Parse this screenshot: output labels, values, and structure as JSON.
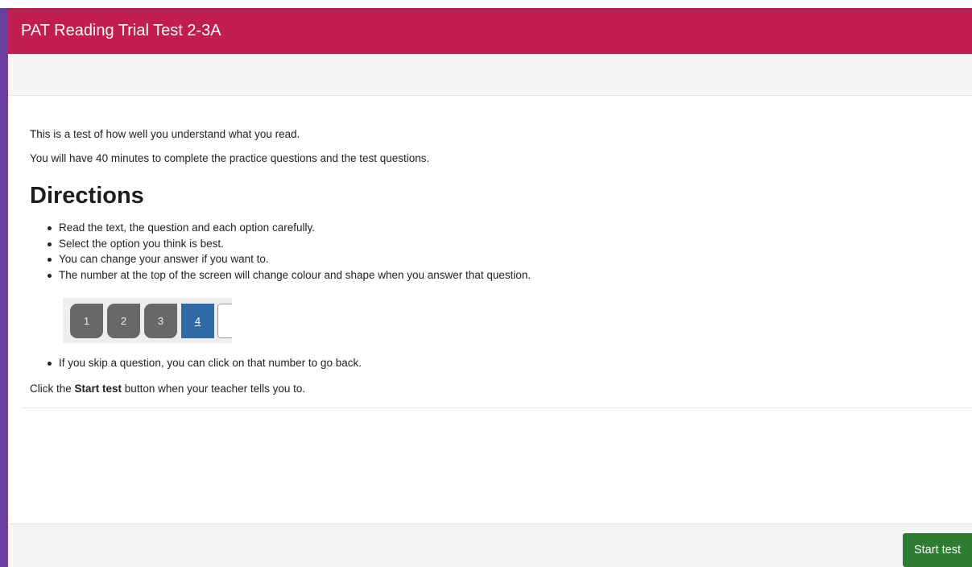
{
  "header": {
    "title": "PAT Reading Trial Test 2-3A"
  },
  "intro": {
    "line1": "This is a test of how well you understand what you read.",
    "line2": "You will have 40 minutes to complete the practice questions and the test questions."
  },
  "directions": {
    "heading": "Directions",
    "items": [
      "Read the text, the question and each option carefully.",
      "Select the option you think is best.",
      "You can change your answer if you want to.",
      "The number at the top of the screen will change colour and shape when you answer that question."
    ],
    "example_numbers": [
      "1",
      "2",
      "3",
      "4"
    ],
    "after_example": "If you skip a question, you can click on that number to go back."
  },
  "instruction": {
    "prefix": "Click the ",
    "bold": "Start test",
    "suffix": " button when your teacher tells you to."
  },
  "footer": {
    "start_button_label": "Start test"
  },
  "colors": {
    "header_bg": "#c11d50",
    "answered_button": "#686868",
    "current_button": "#2e6aa6",
    "start_button": "#2e7d32",
    "window_border": "#6b3fa0"
  }
}
